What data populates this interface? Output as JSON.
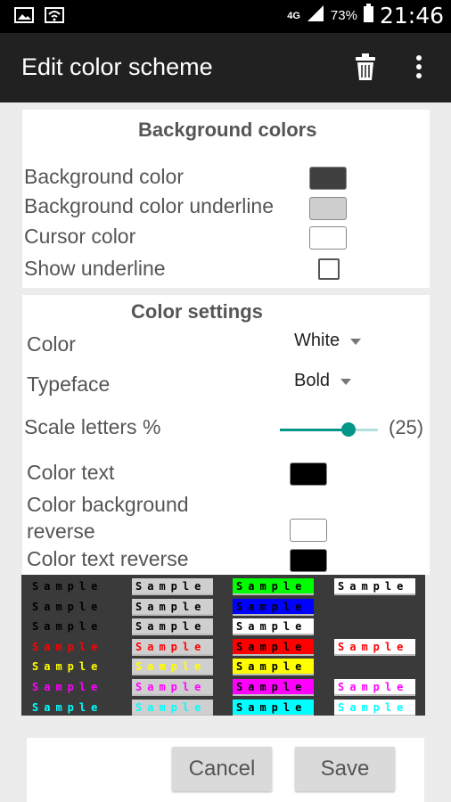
{
  "status_bar": {
    "network": "4G",
    "battery": "73%",
    "time": "21:46"
  },
  "app_bar": {
    "title": "Edit color scheme"
  },
  "background_section": {
    "heading": "Background colors",
    "rows": [
      {
        "label": "Background color",
        "color": "#404040"
      },
      {
        "label": "Background color underline",
        "color": "#cfcfcf"
      },
      {
        "label": "Cursor color",
        "color": "#ffffff"
      },
      {
        "label": "Show underline",
        "checked": false
      }
    ]
  },
  "color_settings": {
    "heading": "Color settings",
    "color_label": "Color",
    "color_value": "White",
    "typeface_label": "Typeface",
    "typeface_value": "Bold",
    "scale_label": "Scale letters %",
    "scale_value": "(25)",
    "scale_fraction": 0.7,
    "color_text_label": "Color text",
    "color_text": "#000000",
    "color_bg_reverse_label": "Color background reverse",
    "color_bg_reverse": "#ffffff",
    "color_text_reverse_label": "Color text reverse",
    "color_text_reverse": "#000000"
  },
  "preview": {
    "sample_text": "Sample",
    "rows": [
      {
        "color": "#000000",
        "bg": "#3a3a3a",
        "c1": "#3a3a3a",
        "c2": "#cfcfcf",
        "c3": "#00ff00",
        "c4": "#ffffff"
      },
      {
        "color": "#000000",
        "bg": "#3a3a3a",
        "c1": "#3a3a3a",
        "c2": "#cfcfcf",
        "c3": "#0000ff",
        "c4": null
      },
      {
        "color": "#000000",
        "bg": "#3a3a3a",
        "c1": "#3a3a3a",
        "c2": "#cfcfcf",
        "c3": "#ffffff",
        "c4": null
      },
      {
        "color": "#ff0000",
        "bg": "#3a3a3a",
        "c1": "#3a3a3a",
        "c2": "#cfcfcf",
        "c3": "#ff0000",
        "c4": "#ffffff"
      },
      {
        "color": "#ffff00",
        "bg": "#3a3a3a",
        "c1": "#3a3a3a",
        "c2": "#cfcfcf",
        "c3": "#ffff00",
        "c4": null
      },
      {
        "color": "#ff00ff",
        "bg": "#3a3a3a",
        "c1": "#3a3a3a",
        "c2": "#cfcfcf",
        "c3": "#ff00ff",
        "c4": "#ffffff"
      },
      {
        "color": "#00ffff",
        "bg": "#3a3a3a",
        "c1": "#3a3a3a",
        "c2": "#cfcfcf",
        "c3": "#00ffff",
        "c4": "#ffffff"
      }
    ]
  },
  "buttons": {
    "cancel": "Cancel",
    "save": "Save"
  }
}
